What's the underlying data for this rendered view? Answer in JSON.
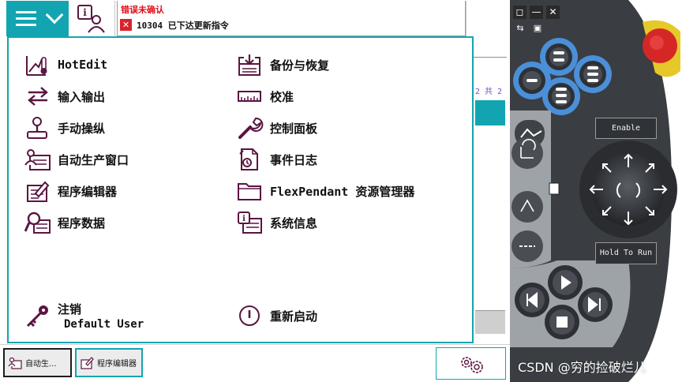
{
  "header": {
    "event_title": "错误未确认",
    "event_message": "10304  已下达更新指令",
    "error_glyph": "✕"
  },
  "background_app": {
    "page_indicator": "2 共 2"
  },
  "menu": {
    "left": [
      {
        "label": "HotEdit",
        "icon": "hotedit-icon"
      },
      {
        "label": "输入输出",
        "icon": "io-arrows-icon"
      },
      {
        "label": "手动操纵",
        "icon": "joystick-icon"
      },
      {
        "label": "自动生产窗口",
        "icon": "production-window-icon"
      },
      {
        "label": "程序编辑器",
        "icon": "program-editor-icon"
      },
      {
        "label": "程序数据",
        "icon": "program-data-icon"
      }
    ],
    "right": [
      {
        "label": "备份与恢复",
        "icon": "backup-restore-icon"
      },
      {
        "label": "校准",
        "icon": "calibration-icon"
      },
      {
        "label": "控制面板",
        "icon": "wrench-icon"
      },
      {
        "label": "事件日志",
        "icon": "event-log-icon"
      },
      {
        "label": "FlexPendant 资源管理器",
        "icon": "folder-icon"
      },
      {
        "label": "系统信息",
        "icon": "system-info-icon"
      }
    ],
    "logoff": {
      "label": "注销",
      "user": "Default User",
      "icon": "key-icon"
    },
    "restart": {
      "label": "重新启动",
      "icon": "power-icon"
    }
  },
  "taskbar": {
    "items": [
      {
        "label": "自动生..."
      },
      {
        "label": "程序编辑器"
      }
    ]
  },
  "pendant": {
    "enable_label": "Enable",
    "hold_to_run_label": "Hold To Run",
    "window_buttons": [
      "◻",
      "—",
      "✕"
    ],
    "tool_buttons": [
      "⇆",
      "▣"
    ]
  },
  "watermark": "CSDN @穷的捡破烂儿",
  "colors": {
    "accent": "#12a5b1",
    "icon": "#5a1540",
    "error": "#e0101c",
    "pendant_body": "#3a3d42",
    "pendant_blue": "#4a8fd8",
    "estop": "#d62727"
  }
}
